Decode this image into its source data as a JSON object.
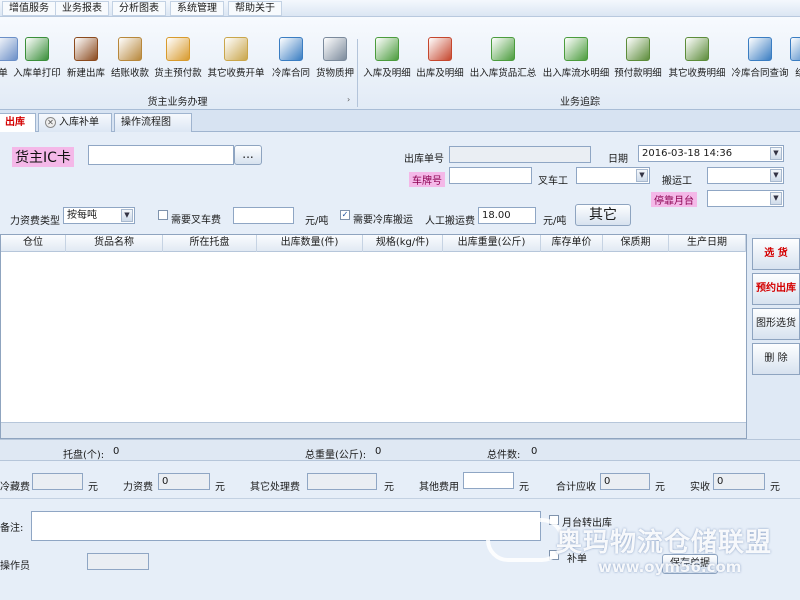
{
  "menu": [
    "增值服务",
    "业务报表",
    "分析图表",
    "系统管理",
    "帮助关于"
  ],
  "ribbon": {
    "group1": {
      "label": "货主业务办理",
      "buttons": [
        {
          "label": "单",
          "icon": "clipboard-icon",
          "color": "#6b8fc7"
        },
        {
          "label": "入库单打印",
          "icon": "printer-icon",
          "color": "#3a8f3a"
        },
        {
          "label": "新建出库",
          "icon": "warehouse-icon",
          "color": "#8b4a1e"
        },
        {
          "label": "结账收款",
          "icon": "ledger-icon",
          "color": "#b7873b"
        },
        {
          "label": "货主预付款",
          "icon": "envelope-money-icon",
          "color": "#d89a2c"
        },
        {
          "label": "其它收费开单",
          "icon": "edit-document-icon",
          "color": "#c9a64b"
        },
        {
          "label": "冷库合同",
          "icon": "contract-icon",
          "color": "#3a7dc2"
        },
        {
          "label": "货物质押",
          "icon": "lock-icon",
          "color": "#7b8a9c"
        }
      ]
    },
    "group2": {
      "label": "业务追踪",
      "buttons": [
        {
          "label": "入库及明细",
          "icon": "doc-arrow-in-icon",
          "color": "#4b9c3d"
        },
        {
          "label": "出库及明细",
          "icon": "doc-arrow-out-icon",
          "color": "#c5462d"
        },
        {
          "label": "出入库货品汇总",
          "icon": "doc-exchange-icon",
          "color": "#4b9c3d"
        },
        {
          "label": "出入库流水明细",
          "icon": "doc-flow-icon",
          "color": "#4b9c3d"
        },
        {
          "label": "预付款明细",
          "icon": "search-money-icon",
          "color": "#5c8c3a"
        },
        {
          "label": "其它收费明细",
          "icon": "money-list-icon",
          "color": "#5c8c3a"
        },
        {
          "label": "冷库合同查询",
          "icon": "contract-search-icon",
          "color": "#3a7dc2"
        },
        {
          "label": "结",
          "icon": "doc-icon",
          "color": "#3a7dc2"
        }
      ]
    }
  },
  "tabs": [
    {
      "label": "出库",
      "active": true
    },
    {
      "label": "入库补单",
      "active": false
    },
    {
      "label": "操作流程图",
      "active": false
    }
  ],
  "form": {
    "owner_ic_label": "货主IC卡",
    "owner_ic_value": "",
    "ellipsis": "...",
    "out_no_label": "出库单号",
    "out_no_value": "",
    "date_label": "日期",
    "date_value": "2016-03-18 14:36",
    "plate_label": "车牌号",
    "plate_value": "",
    "forklift_label": "叉车工",
    "forklift_value": "",
    "porter_label": "搬运工",
    "porter_value": "",
    "dock_label": "停靠月台",
    "dock_value": "",
    "labor_type_label": "力资费类型",
    "labor_type_value": "按每吨",
    "need_forklift_label": "需要叉车费",
    "need_forklift_checked": false,
    "forklift_fee_value": "",
    "unit1": "元/吨",
    "need_cold_label": "需要冷库搬运",
    "need_cold_checked": true,
    "manual_fee_label": "人工搬运费",
    "manual_fee_value": "18.00",
    "unit2": "元/吨",
    "other_button": "其它"
  },
  "grid": {
    "columns": [
      "仓位",
      "货品名称",
      "所在托盘",
      "出库数量(件)",
      "规格(kg/件)",
      "出库重量(公斤)",
      "库存单价",
      "保质期",
      "生产日期"
    ],
    "rows": []
  },
  "side_buttons": [
    "选  货",
    "预约出库",
    "图形选货",
    "删  除"
  ],
  "summary": {
    "pallet_label": "托盘(个):",
    "pallet_value": "0",
    "weight_label": "总重量(公斤):",
    "weight_value": "0",
    "pieces_label": "总件数:",
    "pieces_value": "0"
  },
  "fees": {
    "storage_label": "冷藏费",
    "storage_value": "",
    "labor_label": "力资费",
    "labor_value": "0",
    "other_proc_label": "其它处理费",
    "other_proc_value": "",
    "other_label": "其他费用",
    "other_value": "",
    "total_label": "合计应收",
    "total_value": "0",
    "paid_label": "实收",
    "paid_value": "0",
    "unit": "元"
  },
  "bottom": {
    "remark_label": "备注:",
    "remark_value": "",
    "operator_label": "操作员",
    "operator_value": "",
    "monthly_label": "月台转出库",
    "reissue_label": "补单",
    "save_button": "保存单据"
  },
  "watermark": {
    "text": "奥玛物流仓储联盟",
    "url": "www.oym56.com"
  }
}
